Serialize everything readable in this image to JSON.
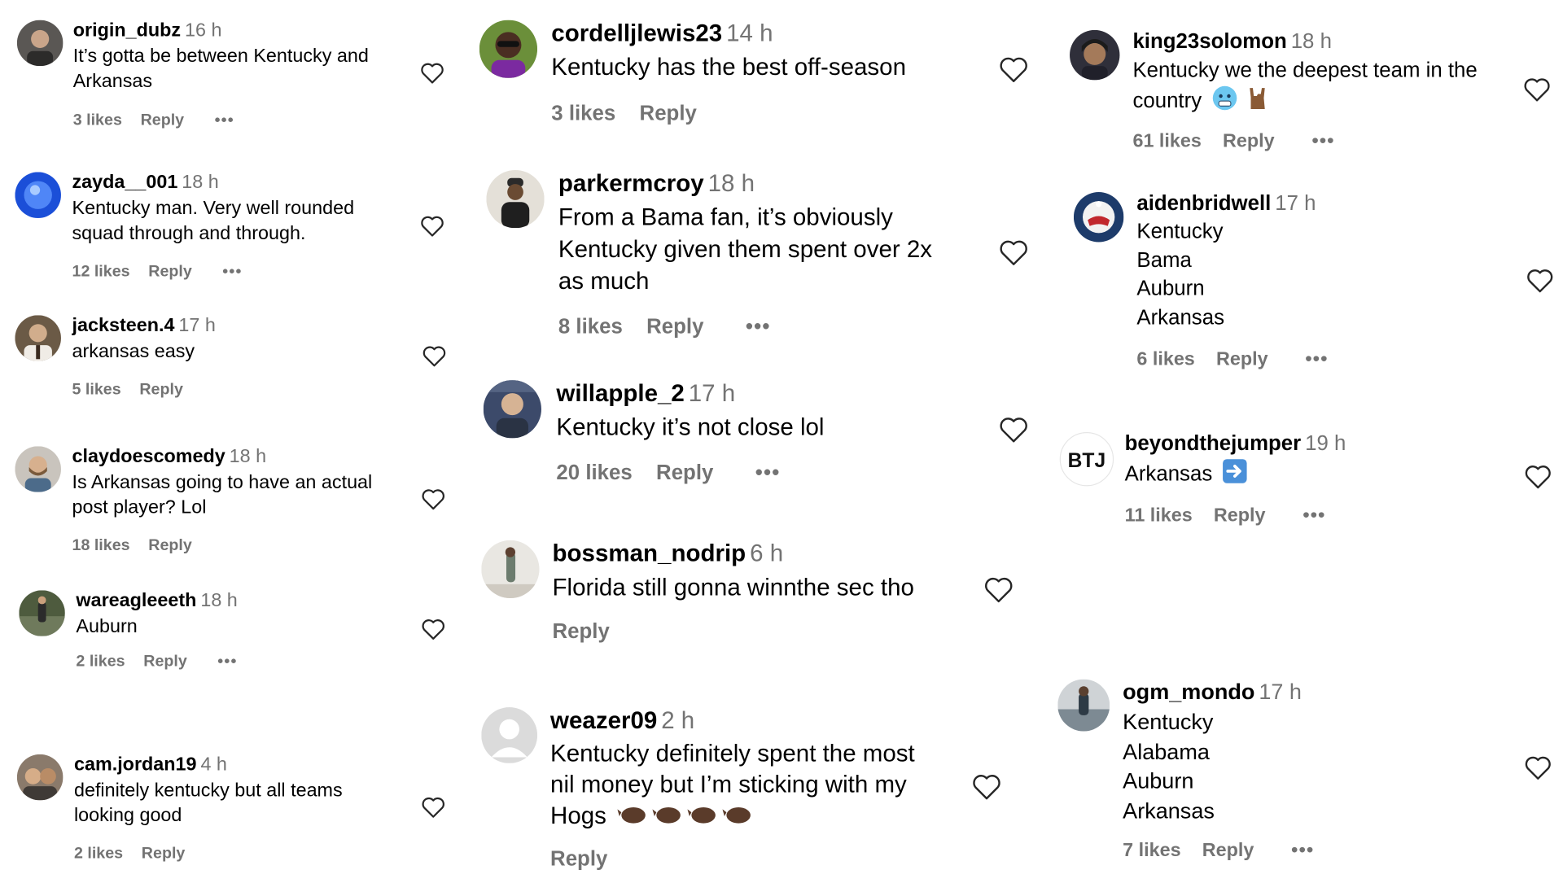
{
  "col1": [
    {
      "user": "origin_dubz",
      "time": "16 h",
      "lines": [
        "It’s gotta be between Kentucky and",
        "Arkansas"
      ],
      "likes": "3 likes",
      "reply": "Reply",
      "more": "•••"
    },
    {
      "user": "zayda__001",
      "time": "18 h",
      "lines": [
        "Kentucky man. Very well rounded",
        "squad through and through."
      ],
      "likes": "12 likes",
      "reply": "Reply",
      "more": "•••"
    },
    {
      "user": "jacksteen.4",
      "time": "17 h",
      "lines": [
        "arkansas easy"
      ],
      "likes": "5 likes",
      "reply": "Reply"
    },
    {
      "user": "claydoescomedy",
      "time": "18 h",
      "lines": [
        "Is Arkansas going to have an actual",
        "post player? Lol"
      ],
      "likes": "18 likes",
      "reply": "Reply"
    },
    {
      "user": "wareagleeeth",
      "time": "18 h",
      "lines": [
        "Auburn"
      ],
      "likes": "2 likes",
      "reply": "Reply",
      "more": "•••"
    },
    {
      "user": "cam.jordan19",
      "time": "4 h",
      "lines": [
        "definitely kentucky but all teams",
        "looking good"
      ],
      "likes": "2 likes",
      "reply": "Reply"
    }
  ],
  "col2": [
    {
      "user": "cordelljlewis23",
      "time": "14 h",
      "lines": [
        "Kentucky has the best off-season"
      ],
      "likes": "3 likes",
      "reply": "Reply"
    },
    {
      "user": "parkermcroy",
      "time": "18 h",
      "lines": [
        "From a Bama fan, it’s obviously",
        "Kentucky given them spent over 2x",
        "as much"
      ],
      "likes": "8 likes",
      "reply": "Reply",
      "more": "•••"
    },
    {
      "user": "willapple_2",
      "time": "17 h",
      "lines": [
        "Kentucky it’s not close lol"
      ],
      "likes": "20 likes",
      "reply": "Reply",
      "more": "•••"
    },
    {
      "user": "bossman_nodrip",
      "time": "6 h",
      "lines": [
        "Florida still gonna winnthe sec tho"
      ],
      "reply": "Reply"
    },
    {
      "user": "weazer09",
      "time": "2 h",
      "lines": [
        "Kentucky definitely spent the most",
        "nil money but I’m sticking with my",
        "Hogs"
      ],
      "reply": "Reply"
    }
  ],
  "col3": [
    {
      "user": "king23solomon",
      "time": "18 h",
      "lines": [
        "Kentucky we the deepest team in the",
        "country"
      ],
      "likes": "61 likes",
      "reply": "Reply",
      "more": "•••"
    },
    {
      "user": "aidenbridwell",
      "time": "17 h",
      "lines": [
        "Kentucky",
        "Bama",
        "Auburn",
        "Arkansas"
      ],
      "likes": "6 likes",
      "reply": "Reply",
      "more": "•••"
    },
    {
      "user": "beyondthejumper",
      "time": "19 h",
      "lines": [
        "Arkansas"
      ],
      "likes": "11 likes",
      "reply": "Reply",
      "more": "•••",
      "avatar_text": "BTJ"
    },
    {
      "user": "ogm_mondo",
      "time": "17 h",
      "lines": [
        "Kentucky",
        "Alabama",
        "Auburn",
        "Arkansas"
      ],
      "likes": "7 likes",
      "reply": "Reply",
      "more": "•••"
    }
  ],
  "icons": {
    "like": "heart-outline-icon",
    "more": "more-options-icon"
  },
  "colors": {
    "text": "#000000",
    "secondary": "#737373",
    "heart": "#262626"
  }
}
